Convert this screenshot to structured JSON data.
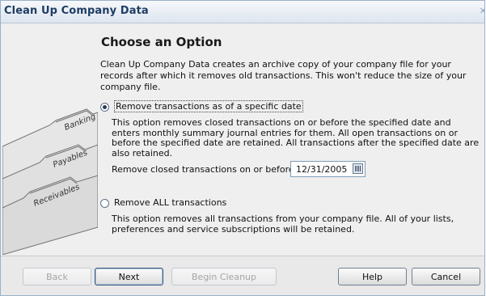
{
  "window": {
    "title": "Clean Up Company Data"
  },
  "sidebar": {
    "folder_tabs": [
      "Banking",
      "Payables",
      "Receivables"
    ]
  },
  "main": {
    "heading": "Choose an Option",
    "intro": "Clean Up Company Data creates an archive copy of your company file for your records after which it removes old transactions. This won't reduce the size of your company file.",
    "options": [
      {
        "label": "Remove transactions as of a specific date",
        "selected": true,
        "description": "This option removes closed transactions on or before the specified date and enters monthly summary journal entries for them.  All open transactions on or before the specified date are retained.  All transactions after the specified date are also retained.",
        "date_label": "Remove closed transactions on or before",
        "date_value": "12/31/2005"
      },
      {
        "label": "Remove ALL transactions",
        "selected": false,
        "description": "This option removes all transactions from your company file.  All of your lists, preferences and service subscriptions will be retained."
      }
    ]
  },
  "footer": {
    "back_label": "Back",
    "next_label": "Next",
    "begin_label": "Begin Cleanup",
    "help_label": "Help",
    "cancel_label": "Cancel"
  },
  "colors": {
    "title_text": "#1f3d63",
    "folder_tab": "#d7d7d7",
    "button_border": "#6f7f91"
  }
}
